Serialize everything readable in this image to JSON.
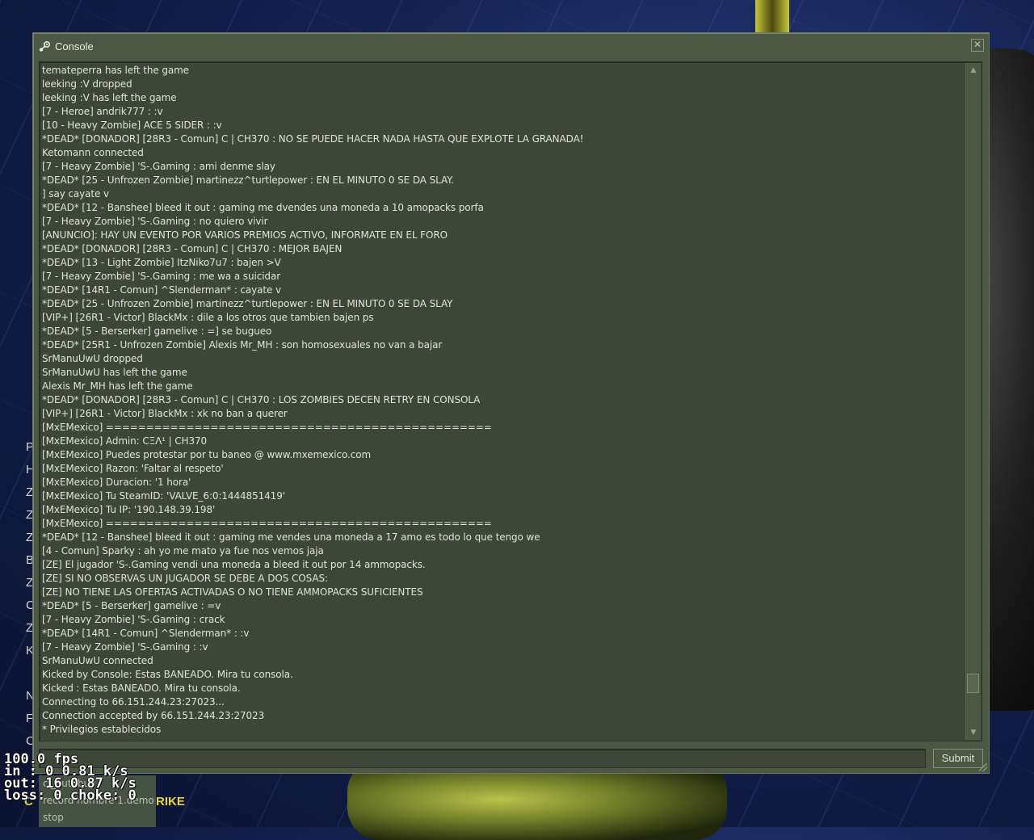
{
  "console": {
    "title": "Console",
    "lines": [
      "temateperra has left the game",
      "leeking :V dropped",
      "leeking :V has left the game",
      "[7 - Heroe] andrik777 : :v",
      "[10 - Heavy Zombie] ACE 5 SIDER : :v",
      "*DEAD* [DONADOR] [28R3 - Comun] C | CH370 : NO SE PUEDE HACER NADA HASTA QUE EXPLOTE LA GRANADA!",
      "Ketomann connected",
      "[7 - Heavy Zombie] 'S-.Gaming : ami denme slay",
      "*DEAD* [25 - Unfrozen Zombie] martinezz^turtlepower : EN EL MINUTO 0 SE DA SLAY.",
      "] say cayate v",
      "*DEAD* [12 - Banshee] bleed it out : gaming me dvendes una moneda a 10 amopacks porfa",
      "[7 - Heavy Zombie] 'S-.Gaming : no quiero vivir",
      "[ANUNCIO]: HAY UN EVENTO POR VARIOS PREMIOS ACTIVO, INFORMATE EN EL FORO",
      "*DEAD* [DONADOR] [28R3 - Comun] C | CH370 : MEJOR BAJEN",
      "*DEAD* [13 - Light Zombie] ItzNiko7u7 : bajen >V",
      "[7 - Heavy Zombie] 'S-.Gaming : me wa a suicidar",
      "*DEAD* [14R1 - Comun] ^Slenderman* : cayate v",
      "*DEAD* [25 - Unfrozen Zombie] martinezz^turtlepower : EN EL MINUTO 0 SE DA SLAY",
      "[VIP+] [26R1 - Victor] BlackMx : dile a los otros que tambien bajen ps",
      "*DEAD* [5 - Berserker] gamelive : =]  se  bugueo",
      "*DEAD* [25R1 - Unfrozen Zombie] Alexis Mr_MH : son homosexuales no van a bajar",
      "SrManuUwU dropped",
      "SrManuUwU has left the game",
      "Alexis Mr_MH has left the game",
      "*DEAD* [DONADOR] [28R3 - Comun] C | CH370 : LOS ZOMBIES DECEN RETRY EN CONSOLA",
      "[VIP+] [26R1 - Victor] BlackMx : xk no ban a querer",
      "[MxEMexico] ================================================",
      "[MxEMexico] Admin: CΞΛ¹ | CH370",
      "[MxEMexico] Puedes protestar por tu baneo @ www.mxemexico.com",
      "[MxEMexico] Razon: 'Faltar al respeto'",
      "[MxEMexico] Duracion: '1 hora'",
      "[MxEMexico] Tu SteamID: 'VALVE_6:0:1444851419'",
      "[MxEMexico] Tu IP: '190.148.39.198'",
      "[MxEMexico] ================================================",
      "*DEAD* [12 - Banshee] bleed it out : gaming me vendes una moneda a 17 amo es todo lo que tengo we",
      "[4 - Comun] Sparky : ah yo me mato ya fue nos vemos jaja",
      "[ZE] El jugador 'S-.Gaming vendi una moneda a bleed it out por 14 ammopacks.",
      "[ZE] SI NO OBSERVAS UN JUGADOR SE DEBE A DOS COSAS:",
      "[ZE] NO TIENE LAS OFERTAS ACTIVADAS O NO TIENE AMMOPACKS SUFICIENTES",
      "*DEAD* [5 - Berserker] gamelive : =v",
      "[7 - Heavy Zombie] 'S-.Gaming : crack",
      "*DEAD* [14R1 - Comun] ^Slenderman* : :v",
      "[7 - Heavy Zombie] 'S-.Gaming : :v",
      "SrManuUwU connected",
      "Kicked by Console:  Estas BANEADO. Mira tu consola.",
      "Kicked : Estas BANEADO. Mira tu consola.",
      "Connecting to 66.151.244.23:27023...",
      "Connection accepted by 66.151.244.23:27023",
      "* Privilegios establecidos"
    ],
    "input": {
      "value": "",
      "placeholder": ""
    },
    "submit_label": "Submit",
    "close_label": "✕"
  },
  "autocomplete": [
    "cl_autobuy",
    "record nombre 1.demo",
    "stop"
  ],
  "logo": {
    "left": "C",
    "right": "RIKE"
  },
  "netgraph": {
    "fps": "100.0 fps",
    "in": "in :  0 0.81 k/s",
    "out": "out:  16 0.87 k/s",
    "loss": "loss: 0 choke:  0"
  },
  "menu_letters": [
    "P",
    "H",
    "Z",
    "Z",
    "Z",
    "B",
    "Z",
    "C",
    "Z",
    "K",
    "",
    "N",
    "F",
    "C"
  ],
  "colors": {
    "window_bg": "#4c5844",
    "log_bg": "#3e4637",
    "text": "#dfe3d8",
    "logo": "#e8d43a"
  }
}
